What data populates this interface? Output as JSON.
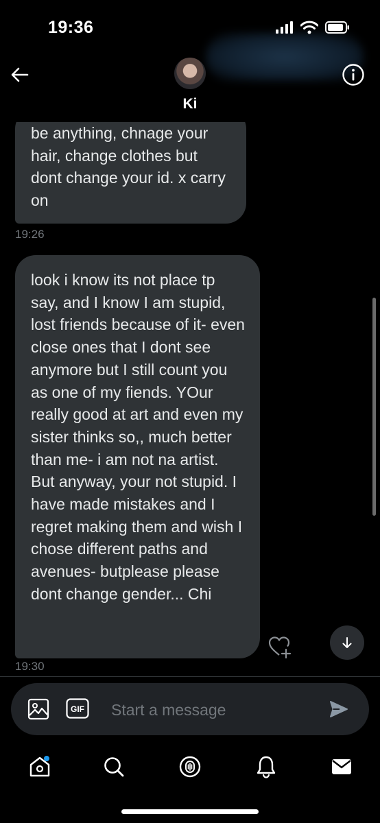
{
  "status": {
    "time": "19:36"
  },
  "header": {
    "contact_name": "Ki"
  },
  "messages": [
    {
      "text": "be anything, chnage your hair, change clothes but dont change your id. x carry on",
      "time": "19:26"
    },
    {
      "text": "look i know its not place tp say, and I know I am stupid, lost friends because of it- even close ones that I dont see anymore but I still count you as one of my fiends. YOur really good at art and even my sister thinks so,, much better than me- i am not na artist. But anyway, your not stupid. I have made mistakes and I regret making them and wish I chose different paths and avenues- butplease please dont change gender... Chi",
      "time": "19:30"
    }
  ],
  "composer": {
    "placeholder": "Start a message",
    "gif_label": "GIF"
  },
  "icons": {
    "back": "arrow-left-icon",
    "info": "info-icon",
    "heart": "heart-plus-icon",
    "jump": "arrow-down-icon",
    "image": "image-icon",
    "send": "send-icon",
    "home": "home-icon",
    "search": "search-icon",
    "spaces": "spaces-mic-icon",
    "notifications": "bell-icon",
    "messages": "envelope-icon"
  },
  "colors": {
    "bubble": "#2f3336",
    "accent": "#1d9bf0"
  }
}
